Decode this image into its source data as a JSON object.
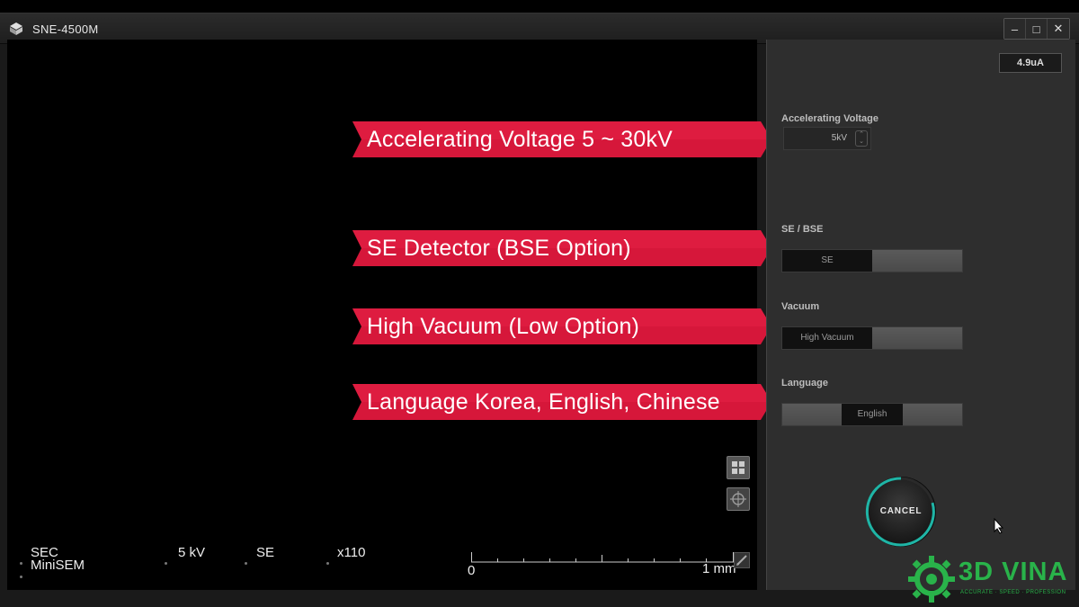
{
  "window": {
    "title": "SNE-4500M",
    "minimize": "–",
    "maximize": "□",
    "close": "✕"
  },
  "banners": [
    {
      "text": "Accelerating Voltage 5 ~ 30kV"
    },
    {
      "text": "SE Detector (BSE Option)"
    },
    {
      "text": "High Vacuum (Low Option)"
    },
    {
      "text": "Language Korea, English, Chinese"
    }
  ],
  "status": {
    "mode": "SEC",
    "model": "MiniSEM",
    "voltage": "5 kV",
    "detector": "SE",
    "magnification": "x110"
  },
  "scale": {
    "start": "0",
    "end": "1 mm"
  },
  "panel": {
    "current": "4.9uA",
    "voltage_label": "Accelerating Voltage",
    "voltage_value": "5kV",
    "detector_label": "SE / BSE",
    "detector_value": "SE",
    "vacuum_label": "Vacuum",
    "vacuum_value": "High Vacuum",
    "language_label": "Language",
    "language_value": "English",
    "cancel": "CANCEL"
  },
  "watermark": {
    "brand": "3D VINA",
    "tagline": "ACCURATE · SPEED · PROFESSION"
  },
  "colors": {
    "banner_red": "#d6173a",
    "accent_teal": "#1fb5a6",
    "brand_green": "#29b34a"
  }
}
